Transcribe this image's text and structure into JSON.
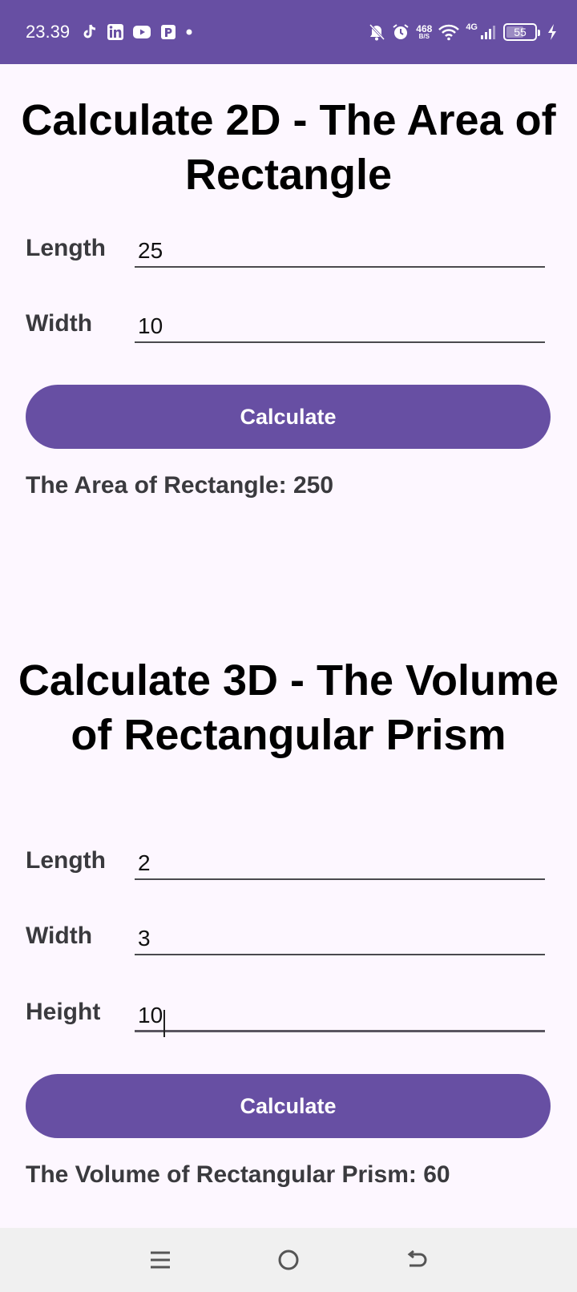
{
  "status_bar": {
    "time": "23.39",
    "apps": [
      "tiktok-icon",
      "linkedin-icon",
      "youtube-icon",
      "parking-app-icon"
    ],
    "net_speed_value": "468",
    "net_speed_unit": "B/S",
    "network": "4G",
    "battery": "55"
  },
  "section_2d": {
    "title": "Calculate 2D - The Area of Rectangle",
    "length_label": "Length",
    "length_value": "25",
    "width_label": "Width",
    "width_value": "10",
    "button_label": "Calculate",
    "result": "The Area of Rectangle: 250"
  },
  "section_3d": {
    "title": "Calculate 3D - The Volume of Rectangular Prism",
    "length_label": "Length",
    "length_value": "2",
    "width_label": "Width",
    "width_value": "3",
    "height_label": "Height",
    "height_value": "10",
    "button_label": "Calculate",
    "result": "The Volume of Rectangular Prism: 60"
  },
  "colors": {
    "primary": "#674FA3",
    "background": "#FDF7FF",
    "nav_bar": "#F0F0F0"
  }
}
